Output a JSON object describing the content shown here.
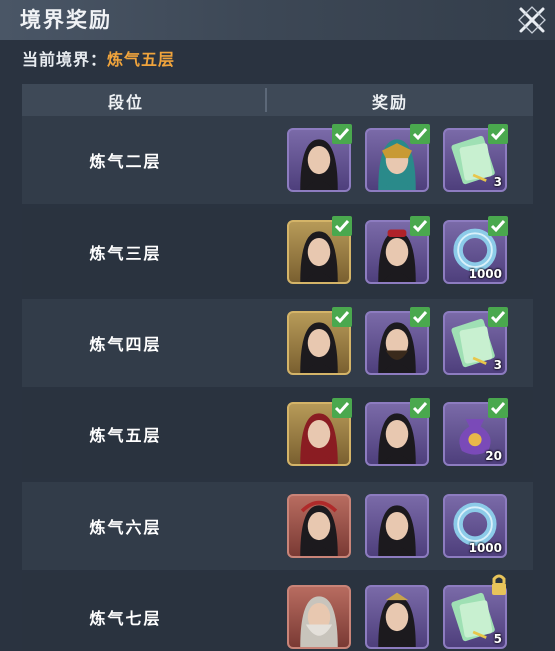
{
  "window": {
    "title": "境界奖励"
  },
  "current_realm": {
    "label": "当前境界：",
    "value": "炼气五层"
  },
  "table": {
    "col_tier": "段位",
    "col_reward": "奖励",
    "rows": [
      {
        "tier": "炼气二层",
        "items": [
          {
            "icon": "male-cultivator-portrait-icon",
            "frame": "purple",
            "qty": "",
            "claimed": true
          },
          {
            "icon": "masked-female-portrait-icon",
            "frame": "purple",
            "qty": "",
            "claimed": true
          },
          {
            "icon": "jade-talisman-icon",
            "frame": "purple",
            "qty": "3",
            "claimed": true
          }
        ]
      },
      {
        "tier": "炼气三层",
        "items": [
          {
            "icon": "female-portrait-icon",
            "frame": "gold",
            "qty": "",
            "claimed": true
          },
          {
            "icon": "female-red-hat-portrait-icon",
            "frame": "purple",
            "qty": "",
            "claimed": true
          },
          {
            "icon": "jade-ring-icon",
            "frame": "purple",
            "qty": "1000",
            "claimed": true
          }
        ]
      },
      {
        "tier": "炼气四层",
        "items": [
          {
            "icon": "female-portrait-icon",
            "frame": "gold",
            "qty": "",
            "claimed": true
          },
          {
            "icon": "bearded-warrior-portrait-icon",
            "frame": "purple",
            "qty": "",
            "claimed": true
          },
          {
            "icon": "jade-talisman-icon",
            "frame": "purple",
            "qty": "3",
            "claimed": true
          }
        ]
      },
      {
        "tier": "炼气五层",
        "items": [
          {
            "icon": "female-red-hood-portrait-icon",
            "frame": "gold",
            "qty": "",
            "claimed": true
          },
          {
            "icon": "male-dark-portrait-icon",
            "frame": "purple",
            "qty": "",
            "claimed": true
          },
          {
            "icon": "pouch-icon",
            "frame": "purple",
            "qty": "20",
            "claimed": true
          }
        ]
      },
      {
        "tier": "炼气六层",
        "items": [
          {
            "icon": "female-red-portrait-icon",
            "frame": "red",
            "qty": "",
            "claimed": false
          },
          {
            "icon": "female-portrait-icon",
            "frame": "purple",
            "qty": "",
            "claimed": false
          },
          {
            "icon": "jade-ring-icon",
            "frame": "purple",
            "qty": "1000",
            "claimed": false
          }
        ]
      },
      {
        "tier": "炼气七层",
        "items": [
          {
            "icon": "elder-portrait-icon",
            "frame": "red",
            "qty": "",
            "claimed": false
          },
          {
            "icon": "female-crowned-portrait-icon",
            "frame": "purple",
            "qty": "",
            "claimed": false
          },
          {
            "icon": "jade-talisman-icon",
            "frame": "purple",
            "qty": "5",
            "claimed": false,
            "locked": true
          }
        ]
      }
    ]
  },
  "colors": {
    "accent": "#f0a43c",
    "claimed": "#4aa84e",
    "lock": "#e8c45a"
  }
}
